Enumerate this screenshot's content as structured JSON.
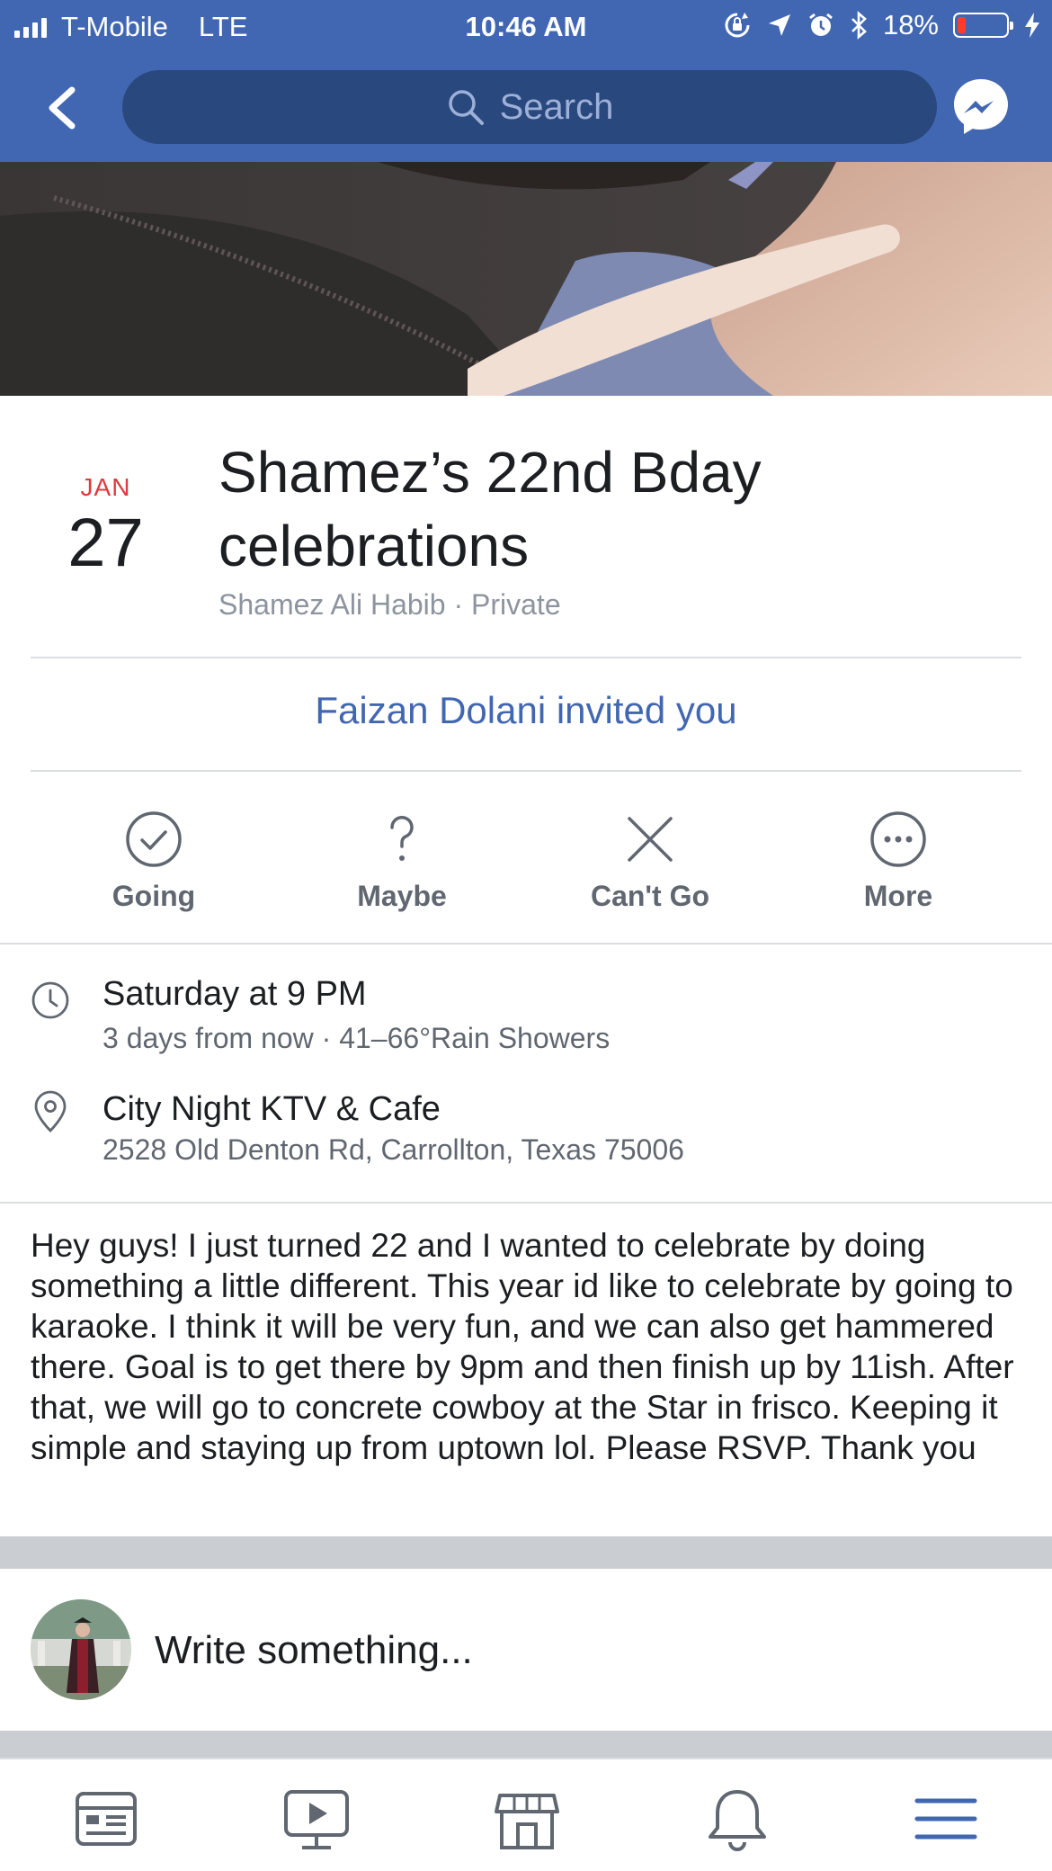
{
  "status_bar": {
    "carrier": "T-Mobile",
    "network": "LTE",
    "time": "10:46 AM",
    "battery": "18%",
    "battery_level": 0.18,
    "battery_color": "#ff3b30"
  },
  "nav": {
    "search_placeholder": "Search",
    "back_icon": "chevron-left-icon",
    "messenger_icon": "messenger-icon"
  },
  "event": {
    "month": "JAN",
    "day": "27",
    "title": "Shamez’s 22nd Bday celebrations",
    "host_privacy": "Shamez Ali Habib · Private",
    "invite_text": "Faizan Dolani invited you"
  },
  "rsvp": [
    {
      "label": "Going",
      "icon": "check-circle-icon"
    },
    {
      "label": "Maybe",
      "icon": "question-icon"
    },
    {
      "label": "Can't Go",
      "icon": "x-icon"
    },
    {
      "label": "More",
      "icon": "more-circle-icon"
    }
  ],
  "details": {
    "time_main": "Saturday at 9 PM",
    "time_sub": "3 days from now · 41–66°Rain Showers",
    "place_main": "City Night KTV & Cafe",
    "place_sub": "2528 Old Denton Rd, Carrollton, Texas 75006"
  },
  "description": "Hey guys! I just turned 22 and I wanted to celebrate by doing something a little different. This year id like to celebrate by going to karaoke. I think it will be very fun, and we can also get hammered there. Goal is to get there by 9pm and then finish up by 11ish. After that, we will go to concrete cowboy at the Star in frisco. Keeping it simple and staying up from uptown lol. Please RSVP. Thank you",
  "composer": {
    "placeholder": "Write something..."
  },
  "tabbar": [
    {
      "icon": "news-feed-icon"
    },
    {
      "icon": "watch-icon"
    },
    {
      "icon": "marketplace-icon"
    },
    {
      "icon": "notifications-icon"
    },
    {
      "icon": "menu-icon"
    }
  ],
  "colors": {
    "brand_blue": "#4267b2",
    "date_red": "#e0393e",
    "active_tab": "#4267b2"
  }
}
